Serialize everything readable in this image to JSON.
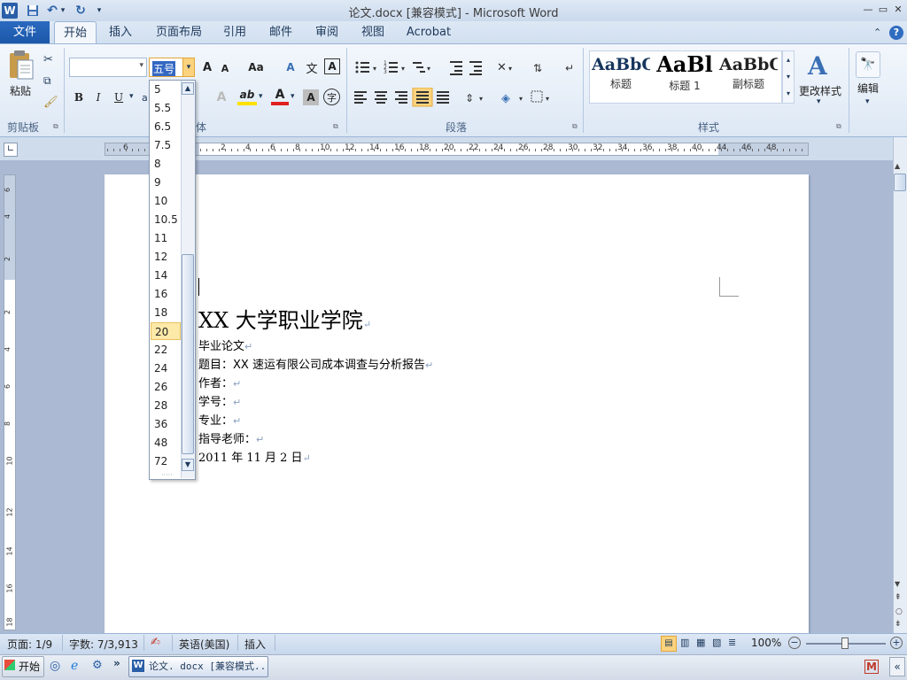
{
  "window": {
    "title": "论文.docx [兼容模式]  -  Microsoft Word",
    "minimize": "—",
    "restore": "▭",
    "close": "✕"
  },
  "quick_access": {
    "word_icon": "W",
    "save": "💾",
    "undo": "↶",
    "redo": "↻",
    "customize": "▾"
  },
  "tabs": {
    "file": "文件",
    "home": "开始",
    "insert": "插入",
    "page_layout": "页面布局",
    "references": "引用",
    "mailings": "邮件",
    "review": "审阅",
    "view": "视图",
    "acrobat": "Acrobat"
  },
  "ribbon": {
    "clipboard": {
      "label": "剪贴板",
      "paste": "粘贴"
    },
    "font": {
      "label": "体",
      "font_name": "",
      "font_size": "五号",
      "grow": "A",
      "shrink": "A",
      "case": "Aa",
      "clear": "A",
      "phonetic": "文",
      "border": "A",
      "bold": "B",
      "italic": "I",
      "underline": "U",
      "highlight": "ab",
      "font_color": "A",
      "shading": "A",
      "enclose": "字"
    },
    "paragraph": {
      "label": "段落"
    },
    "styles": {
      "label": "样式",
      "items": [
        {
          "sample": "AaBbC",
          "name": "标题"
        },
        {
          "sample": "AaBl",
          "name": "标题 1"
        },
        {
          "sample": "AaBbC",
          "name": "副标题"
        }
      ],
      "change_styles": "更改样式"
    },
    "editing": {
      "label": "编辑"
    }
  },
  "font_size_list": {
    "options": [
      "5",
      "5.5",
      "6.5",
      "7.5",
      "8",
      "9",
      "10",
      "10.5",
      "11",
      "12",
      "14",
      "16",
      "18",
      "20",
      "22",
      "24",
      "26",
      "28",
      "36",
      "48",
      "72"
    ],
    "selected": "20"
  },
  "ruler": {
    "left_ticks": [
      "6",
      "4"
    ],
    "ticks": [
      "2",
      "4",
      "6",
      "8",
      "10",
      "12",
      "14",
      "16",
      "18",
      "20",
      "22",
      "24",
      "26",
      "28",
      "30",
      "32",
      "34",
      "36",
      "38",
      "40",
      "44",
      "46",
      "48"
    ]
  },
  "vruler": {
    "ticks": [
      "6",
      "4",
      "2",
      "2",
      "4",
      "6",
      "8",
      "10",
      "12",
      "14",
      "16",
      "18"
    ]
  },
  "document": {
    "heading": "XX 大学职业学院",
    "lines": [
      "毕业论文",
      "题目：XX 速运有限公司成本调查与分析报告",
      "作者：",
      "学号：",
      "专业：",
      "指导老师：",
      "2011 年 11 月 2 日"
    ],
    "para_mark": "↵"
  },
  "status": {
    "page": "页面: 1/9",
    "words": "字数: 7/3,913",
    "language": "英语(美国)",
    "mode": "插入",
    "zoom": "100%"
  },
  "taskbar": {
    "start": "开始",
    "task_item": "论文. docx [兼容模式..."
  }
}
